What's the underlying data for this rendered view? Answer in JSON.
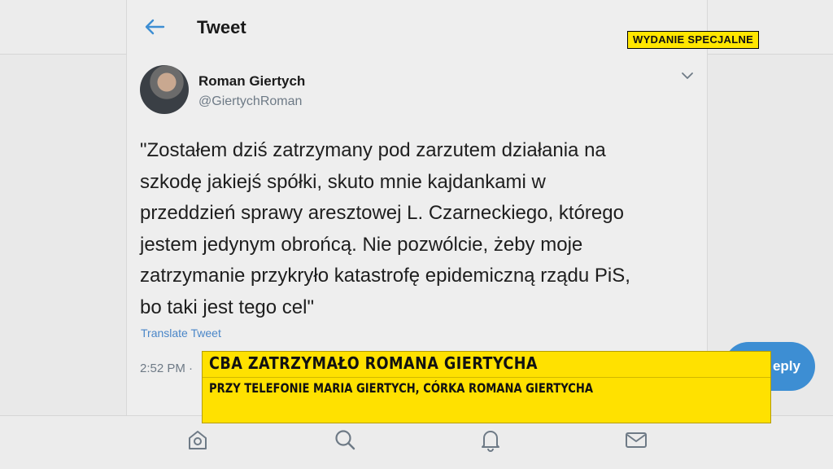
{
  "header": {
    "title": "Tweet",
    "back_icon": "arrow-left-icon"
  },
  "badge": {
    "label": "WYDANIE SPECJALNE",
    "color": "#ffe600"
  },
  "tweet": {
    "author_name": "Roman Giertych",
    "author_handle": "@GiertychRoman",
    "text_lines": [
      "\"Zostałem dziś zatrzymany pod zarzutem działania na",
      "szkodę jakiejś spółki, skuto mnie kajdankami w",
      "przeddzień sprawy aresztowej L. Czarneckiego, którego",
      "jestem jedynym obrońcą. Nie pozwólcie, żeby moje",
      "zatrzymanie przykryło katastrofę epidemiczną rządu PiS,",
      "bo taki jest tego cel\""
    ],
    "translate_label": "Translate Tweet",
    "time": "2:52 PM ·"
  },
  "reply_button": {
    "label": "eply",
    "color": "#3d8ed3"
  },
  "ticker": {
    "headline": "CBA ZATRZYMAŁO ROMANA GIERTYCHA",
    "subline": "PRZY TELEFONIE MARIA GIERTYCH, CÓRKA ROMANA GIERTYCHA",
    "color": "#ffe100"
  },
  "bottom_nav": {
    "items": [
      "home-icon",
      "search-icon",
      "notifications-icon",
      "messages-icon"
    ]
  }
}
